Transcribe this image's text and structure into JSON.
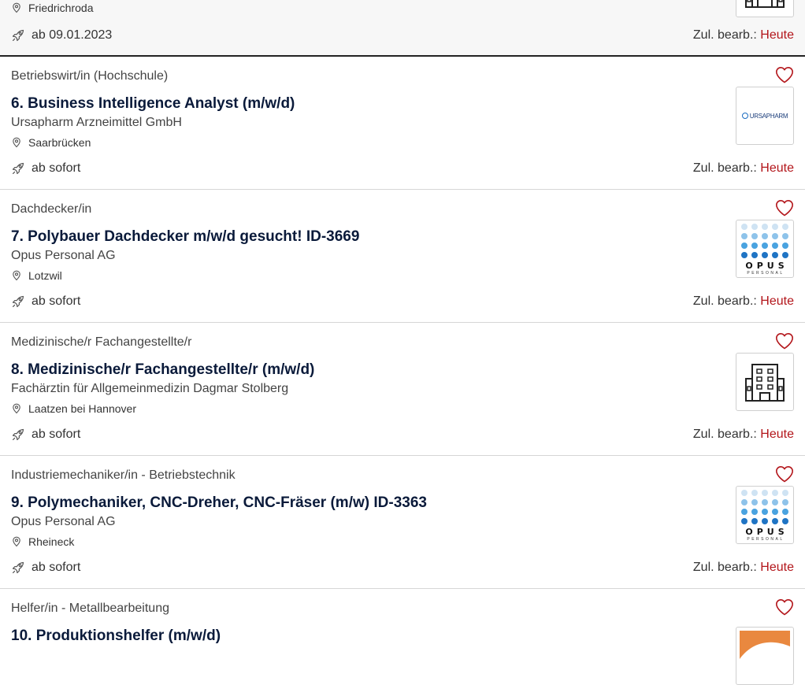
{
  "labels": {
    "edit_prefix": "Zul. bearb.:",
    "edit_value": "Heute"
  },
  "jobs": [
    {
      "location": "Friedrichroda",
      "start": "ab 09.01.2023",
      "logo": "building-icon"
    },
    {
      "category": "Betriebswirt/in (Hochschule)",
      "title": "6. Business Intelligence Analyst (m/w/d)",
      "company": "Ursapharm Arzneimittel GmbH",
      "location": "Saarbrücken",
      "start": "ab sofort",
      "logo": "ursapharm-logo",
      "logo_text": "URSAPHARM"
    },
    {
      "category": "Dachdecker/in",
      "title": "7. Polybauer Dachdecker m/w/d gesucht! ID-3669",
      "company": "Opus Personal AG",
      "location": "Lotzwil",
      "start": "ab sofort",
      "logo": "opus-logo",
      "logo_word": "OPUS",
      "logo_sub": "PERSONAL"
    },
    {
      "category": "Medizinische/r Fachangestellte/r",
      "title": "8. Medizinische/r Fachangestellte/r (m/w/d)",
      "company": "Fachärztin für Allgemeinmedizin Dagmar Stolberg",
      "location": "Laatzen bei Hannover",
      "start": "ab sofort",
      "logo": "building-icon"
    },
    {
      "category": "Industriemechaniker/in - Betriebstechnik",
      "title": "9. Polymechaniker, CNC-Dreher, CNC-Fräser (m/w) ID-3363",
      "company": "Opus Personal AG",
      "location": "Rheineck",
      "start": "ab sofort",
      "logo": "opus-logo",
      "logo_word": "OPUS",
      "logo_sub": "PERSONAL"
    },
    {
      "category": "Helfer/in - Metallbearbeitung",
      "title": "10. Produktionshelfer (m/w/d)",
      "logo": "orange-company-logo"
    }
  ],
  "colors": {
    "accent_today": "#b3161b",
    "title": "#0a1a3a",
    "heart": "#b3161b",
    "opus_dot_light": "#cfe3f3",
    "opus_dot_mid": "#8ec3ea",
    "opus_dot_strong": "#4aa3e0",
    "opus_dot_dark": "#1f74c4"
  }
}
